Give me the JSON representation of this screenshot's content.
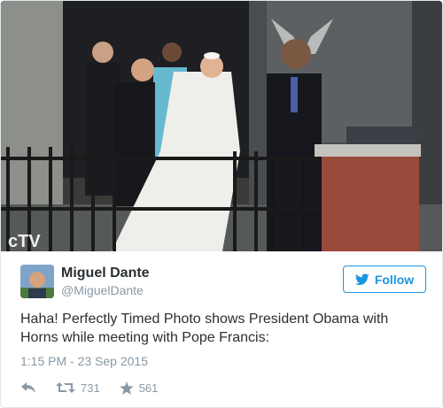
{
  "media": {
    "watermark": "cTV"
  },
  "tweet": {
    "author_name": "Miguel Dante",
    "author_handle": "@MiguelDante",
    "follow_label": "Follow",
    "text": "Haha! Perfectly Timed Photo shows President Obama with Horns while meeting with Pope Francis:",
    "timestamp": "1:15 PM - 23 Sep 2015",
    "retweet_count": "731",
    "like_count": "561"
  },
  "icons": {
    "follow": "twitter-bird-icon",
    "reply": "reply-icon",
    "retweet": "retweet-icon",
    "like": "star-icon"
  },
  "colors": {
    "accent": "#1b95e0",
    "muted": "#8899a6",
    "text": "#292f33"
  }
}
